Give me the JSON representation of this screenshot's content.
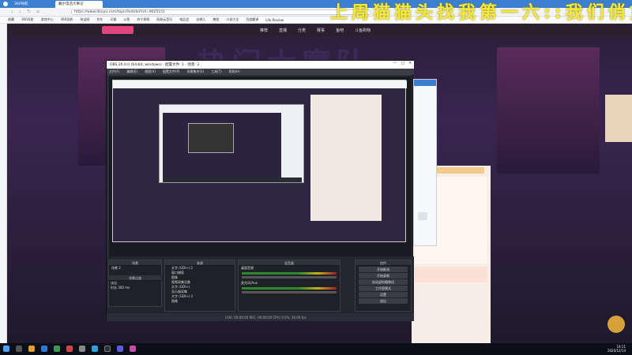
{
  "browser": {
    "tabs": [
      {
        "label": "360导航"
      },
      {
        "label": "戴尔电话大事记",
        "active": true
      }
    ],
    "url": "https://www.douyu.com/topic/hotidol?rid=9025151",
    "bookmarks": [
      "收藏",
      "360导航",
      "游戏中心",
      "360导航",
      "淘宝网",
      "京东",
      "天猫",
      "斗鱼",
      "苏宁易购",
      "网易云音乐",
      "唯品会",
      "去哪儿",
      "携程",
      "小说大全",
      "百度翻译",
      "Life Review"
    ]
  },
  "site": {
    "nav": [
      "推荐",
      "直播",
      "分类",
      "赛事",
      "鱼吧",
      "斗鱼购物"
    ],
    "banner": "热门大魔队"
  },
  "overlay": {
    "title": "上周猫猫头找我第一六::我们俏货"
  },
  "obs": {
    "title": "OBS 26.0.0 (64-bit, windows) - 配置文件: 1 - 场景: 2",
    "menu": [
      "文件(F)",
      "编辑(E)",
      "视图(V)",
      "配置文件(P)",
      "场景集合(S)",
      "工具(T)",
      "帮助(H)"
    ],
    "panels": {
      "scenes": "场景",
      "sources": "来源",
      "mixer": "混音器",
      "transitions": "场景过渡",
      "controls": "控件"
    },
    "sources": [
      "文字 (GDI+) 2",
      "窗口捕获",
      "图像",
      "视频采集设备",
      "文字 (GDI+)",
      "显示器采集",
      "文字 (GDI+) 3",
      "图像"
    ],
    "scene_items": [
      "场景 2"
    ],
    "mixer": [
      {
        "label": "桌面音频"
      },
      {
        "label": "麦克风/Aux"
      }
    ],
    "transition": {
      "type": "淡出",
      "duration_label": "时长",
      "duration": "300 ms"
    },
    "controls": [
      "开始推流",
      "开始录制",
      "启动虚拟摄像机",
      "工作室模式",
      "设置",
      "退出"
    ],
    "status": "LIVE: 00:00:00   REC: 00:00:00   CPU: 0.5%, 30.00 fps"
  },
  "taskbar": {
    "time": "19:11",
    "date": "2020/12/14"
  }
}
